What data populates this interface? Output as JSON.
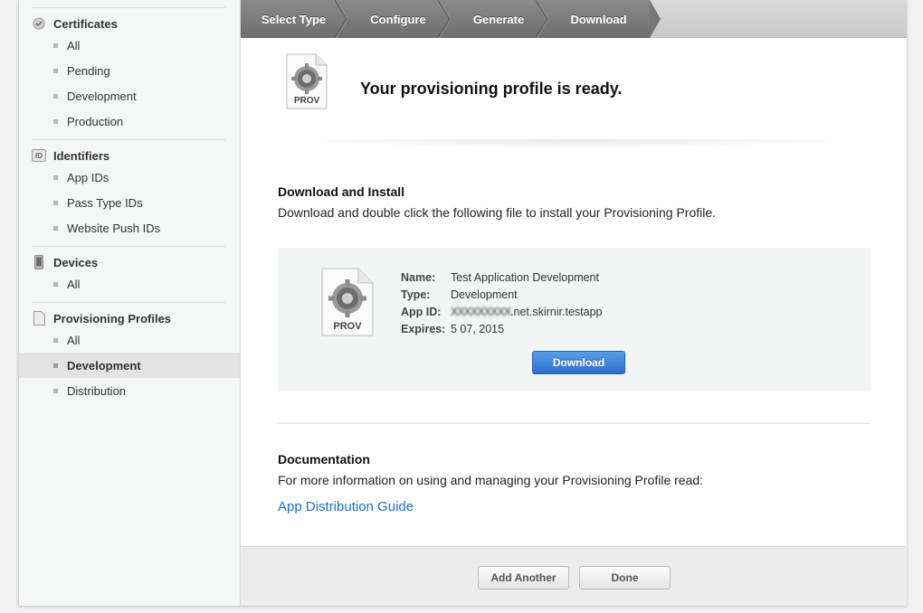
{
  "sidebar": {
    "groups": [
      {
        "title": "Certificates",
        "icon": "certificate-icon",
        "items": [
          "All",
          "Pending",
          "Development",
          "Production"
        ]
      },
      {
        "title": "Identifiers",
        "icon": "id-badge-icon",
        "id_badge_text": "ID",
        "items": [
          "App IDs",
          "Pass Type IDs",
          "Website Push IDs"
        ]
      },
      {
        "title": "Devices",
        "icon": "iphone-icon",
        "items": [
          "All"
        ]
      },
      {
        "title": "Provisioning Profiles",
        "icon": "document-icon",
        "items": [
          "All",
          "Development",
          "Distribution"
        ],
        "active_item": "Development"
      }
    ]
  },
  "steps": [
    "Select Type",
    "Configure",
    "Generate",
    "Download"
  ],
  "hero": {
    "title": "Your provisioning profile is ready.",
    "icon_label": "PROV"
  },
  "download_section": {
    "title": "Download and Install",
    "text": "Download and double click the following file to install your Provisioning Profile."
  },
  "profile": {
    "icon_label": "PROV",
    "name_key": "Name:",
    "name": "Test Application Development",
    "type_key": "Type:",
    "type": "Development",
    "app_id_key": "App ID:",
    "app_id_prefix": "XXXXXXXXX",
    "app_id_suffix": ".net.skirnir.testapp",
    "expires_key": "Expires:",
    "expires": "5 07, 2015",
    "download_label": "Download"
  },
  "documentation": {
    "title": "Documentation",
    "text": "For more information on using and managing your Provisioning Profile read:",
    "link": "App Distribution Guide"
  },
  "footer": {
    "add_another_label": "Add Another",
    "done_label": "Done"
  },
  "colors": {
    "accent": "#2c6fcb",
    "link": "#1a6ec9",
    "step_active_bg": "#6e6e6e"
  }
}
